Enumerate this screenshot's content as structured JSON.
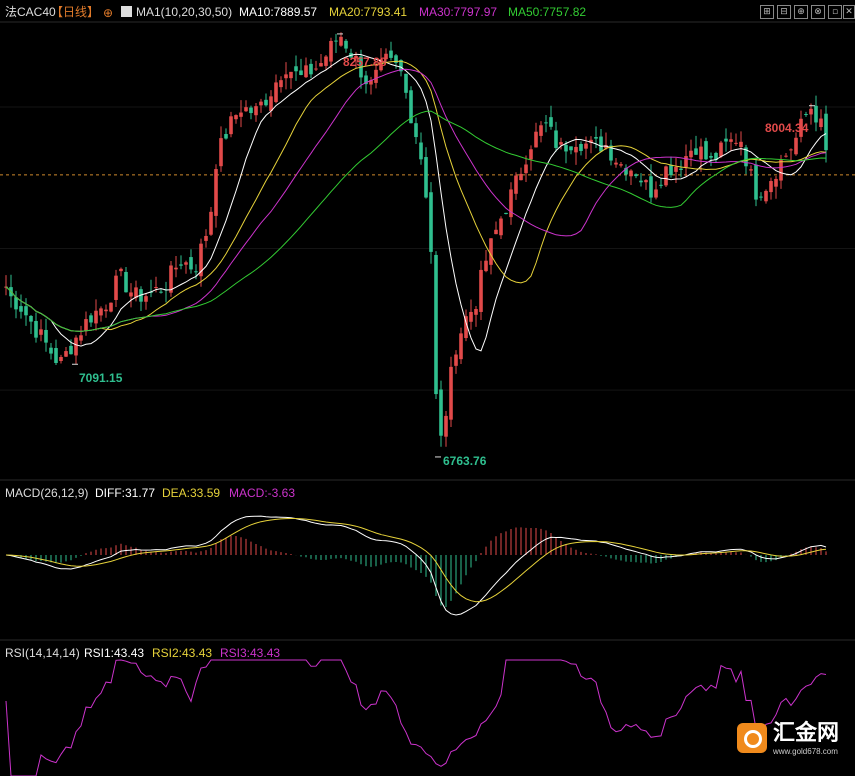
{
  "header": {
    "symbol": "法CAC40",
    "period": "【日线】",
    "period_icon": "⊕",
    "ma_icon": "chart-icon",
    "ma_label": "MA1(10,20,30,50)",
    "ma10": "MA10:7889.57",
    "ma20": "MA20:7793.41",
    "ma30": "MA30:7797.97",
    "ma50": "MA50:7757.82"
  },
  "toolbar": {
    "b1": "⊞",
    "b2": "⊟",
    "b3": "⊕",
    "b4": "⊗",
    "b5": "▫",
    "b6": "✕"
  },
  "macd": {
    "label": "MACD(26,12,9)",
    "diff": "DIFF:31.77",
    "dea": "DEA:33.59",
    "macd": "MACD:-3.63"
  },
  "rsi": {
    "label": "RSI(14,14,14)",
    "rsi1": "RSI1:43.43",
    "rsi2": "RSI2:43.43",
    "rsi3": "RSI3:43.43"
  },
  "annotations": {
    "high1": "8257.88",
    "low1": "7091.15",
    "low2": "6763.76",
    "high2": "8004.34"
  },
  "watermark": {
    "name": "汇金网",
    "url": "www.gold678.com"
  },
  "colors": {
    "up": "#e24a4a",
    "down": "#2fbf8f",
    "ma10": "#ffffff",
    "ma20": "#e6d23a",
    "ma30": "#cc33cc",
    "ma50": "#33cc33",
    "bg": "#000000",
    "dashed": "#d08a2c"
  },
  "chart_data": {
    "type": "candlestick",
    "instrument": "CAC40",
    "period": "daily",
    "price_range": [
      6700,
      8300
    ],
    "current_price": 7760,
    "moving_averages": {
      "MA10": 7889.57,
      "MA20": 7793.41,
      "MA30": 7797.97,
      "MA50": 7757.82
    },
    "price_path": [
      [
        0,
        7420
      ],
      [
        10,
        7330
      ],
      [
        20,
        7300
      ],
      [
        35,
        7220
      ],
      [
        50,
        7140
      ],
      [
        60,
        7091.15
      ],
      [
        75,
        7180
      ],
      [
        90,
        7260
      ],
      [
        105,
        7300
      ],
      [
        120,
        7400
      ],
      [
        135,
        7330
      ],
      [
        150,
        7340
      ],
      [
        165,
        7370
      ],
      [
        180,
        7460
      ],
      [
        195,
        7430
      ],
      [
        210,
        7600
      ],
      [
        215,
        7800
      ],
      [
        225,
        7900
      ],
      [
        240,
        8000
      ],
      [
        255,
        7980
      ],
      [
        270,
        8050
      ],
      [
        285,
        8150
      ],
      [
        300,
        8100
      ],
      [
        320,
        8150
      ],
      [
        340,
        8257.88
      ],
      [
        355,
        8170
      ],
      [
        370,
        8070
      ],
      [
        385,
        8160
      ],
      [
        400,
        8130
      ],
      [
        410,
        7990
      ],
      [
        420,
        7850
      ],
      [
        430,
        7600
      ],
      [
        438,
        6763.76
      ],
      [
        445,
        6900
      ],
      [
        455,
        7150
      ],
      [
        465,
        7250
      ],
      [
        475,
        7300
      ],
      [
        485,
        7450
      ],
      [
        500,
        7600
      ],
      [
        515,
        7720
      ],
      [
        530,
        7870
      ],
      [
        545,
        7940
      ],
      [
        560,
        7850
      ],
      [
        575,
        7890
      ],
      [
        590,
        7860
      ],
      [
        605,
        7870
      ],
      [
        620,
        7800
      ],
      [
        635,
        7780
      ],
      [
        650,
        7700
      ],
      [
        665,
        7780
      ],
      [
        680,
        7800
      ],
      [
        695,
        7870
      ],
      [
        710,
        7800
      ],
      [
        725,
        7860
      ],
      [
        740,
        7900
      ],
      [
        755,
        7700
      ],
      [
        765,
        7720
      ],
      [
        780,
        7800
      ],
      [
        795,
        7880
      ],
      [
        810,
        8004.34
      ],
      [
        820,
        7950
      ],
      [
        830,
        7760
      ]
    ],
    "macd": {
      "params": [
        26,
        12,
        9
      ],
      "DIFF": 31.77,
      "DEA": 33.59,
      "MACD": -3.63
    },
    "rsi": {
      "params": [
        14,
        14,
        14
      ],
      "RSI1": 43.43,
      "RSI2": 43.43,
      "RSI3": 43.43
    }
  }
}
